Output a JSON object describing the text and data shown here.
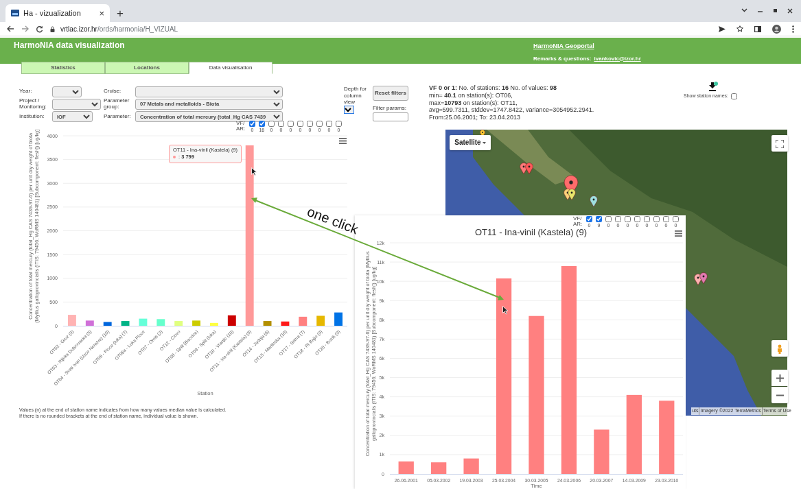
{
  "browser": {
    "tab_title": "Ha - vizualization",
    "tab_close": "×",
    "new_tab": "+",
    "url_host": "vrtlac.izor.hr",
    "url_path": "/ords/harmonia/H_VIZUAL"
  },
  "header": {
    "title": "HarmoNIA data visualization",
    "geoportal_link": "HarmoNIA Geoportal",
    "remarks_label": "Remarks & questions:",
    "remarks_email": "ivankovic@izor.hr"
  },
  "tabs": [
    {
      "label": "Statistics",
      "selected": false
    },
    {
      "label": "Locations",
      "selected": false
    },
    {
      "label": "Data visualisation",
      "selected": true
    }
  ],
  "filters": [
    {
      "label": "Year:"
    },
    {
      "label": "Cruise:"
    },
    {
      "label": "Project / Monitoring:"
    },
    {
      "label": "Parameter group:",
      "value": "07 Metals and metalloids - Biota"
    },
    {
      "label": "Institution:",
      "value": "IOF"
    },
    {
      "label": "Parameter:",
      "value": "Concentration of total mercury (total_Hg CAS 7439"
    }
  ],
  "depth": {
    "label": "Depth for column view"
  },
  "reset_button": "Reset filters",
  "filter_params": {
    "label": "Filter params:"
  },
  "station_chart": {
    "vf_ar": {
      "label_top": "VF/",
      "label_bottom": "AR:",
      "items": [
        {
          "checked": true,
          "count": "0"
        },
        {
          "checked": true,
          "count": "16"
        },
        {
          "checked": false,
          "count": "0"
        },
        {
          "checked": false,
          "count": "0"
        },
        {
          "checked": false,
          "count": "0"
        },
        {
          "checked": false,
          "count": "0"
        },
        {
          "checked": false,
          "count": "0"
        },
        {
          "checked": false,
          "count": "0"
        },
        {
          "checked": false,
          "count": "0"
        },
        {
          "checked": false,
          "count": "0"
        }
      ]
    },
    "tooltip": {
      "title": "OT11 - Ina-vinil (Kastela) (9)",
      "value": ": **3 799**",
      "color": "#ff9999"
    },
    "chart_data": {
      "type": "bar",
      "xlabel": "Station",
      "ylabel": "Concentration of total mercury (total_Hg CAS 7439-97-6) per unit dry weight of biota (Mytilus galloprovincialis (ITIS: 79456; WoRMS 140481) [Subcomponent: flesh]) [ug/kg]",
      "categories": [
        "OT02 - Gruz (9)",
        "OT03 - Rijeka Dubrovacka (5)",
        "OT04 - Sveti Ivan (Usce Neretve) (10)",
        "OT06 - Ploce (luka) (7)",
        "OT06a - Luka Ploce",
        "OT07 - Omis (3)",
        "OT12 - Ciovo",
        "OT08 - Split (Bacvice)",
        "OT09 - Split (luka)",
        "OT10 - Vranjic (10)",
        "OT11 - Ina-vinil (Kastela) (9)",
        "OT14 - Jadrija (6)",
        "OT15 - Martinska (10)",
        "OT17 - Srima (7)",
        "OT18 - Rt Bajlo (9)",
        "OT20 - Bozik (9)"
      ],
      "grid": true,
      "series": [
        {
          "colors": [
            "#ffb3b3",
            "#d070d8",
            "#0066dd",
            "#00b386",
            "#66ffd9",
            "#66ffcc",
            "#e0ff80",
            "#cccc00",
            "#ffff40",
            "#cc0000",
            "#ff9999",
            "#b38f00",
            "#ff1a1a",
            "#ff8080",
            "#e6b800",
            "#0073e6"
          ],
          "values": [
            230,
            110,
            80,
            100,
            150,
            140,
            100,
            110,
            60,
            220,
            3799,
            100,
            90,
            190,
            210,
            280
          ]
        }
      ],
      "ylim": [
        0,
        4000
      ],
      "yticks": [
        0,
        500,
        1000,
        1500,
        2000,
        2500,
        3000,
        3500,
        4000
      ]
    }
  },
  "notes": [
    "Values (n) at the end of station name indicates from how many values median value is calculated.",
    "If there is no rounded brackets at the end of station name, individual value is shown."
  ],
  "summary": [
    "**VF 0 or 1:** No. of stations: **16** No. of values: **98**",
    "min= **40.1** on station(s): OT06,",
    "max=**10793** on station(s): OT11,",
    "avg=599.7311, stddev=1747.8422, variance=3054952.2941.",
    "From:25.06.2001; To: 23.04.2013"
  ],
  "show_station_names": {
    "label": "Show station names:",
    "checked": false
  },
  "map": {
    "type_button": "Satellite",
    "attribution": [
      "uts",
      "Imagery ©2022 TerraMetrics",
      "Terms of Use"
    ]
  },
  "popup_chart": {
    "vf_ar": {
      "label_top": "VF/",
      "label_bottom": "AR:",
      "items": [
        {
          "checked": true,
          "count": "0"
        },
        {
          "checked": true,
          "count": "9"
        },
        {
          "checked": false,
          "count": "0"
        },
        {
          "checked": false,
          "count": "0"
        },
        {
          "checked": false,
          "count": "0"
        },
        {
          "checked": false,
          "count": "0"
        },
        {
          "checked": false,
          "count": "0"
        },
        {
          "checked": false,
          "count": "0"
        },
        {
          "checked": false,
          "count": "0"
        },
        {
          "checked": false,
          "count": "0"
        }
      ]
    },
    "chart_data": {
      "type": "bar",
      "title": "OT11 - Ina-vinil (Kastela) (9)",
      "xlabel": "Time",
      "ylabel": "Concentration of total mercury (total_Hg CAS 7439-97-6) per unit dry weight of biota (Mytilus galloprovincialis (ITIS: 79456; WoRMS 140481) [Subcomponent: flesh]) [ug/kg]",
      "categories": [
        "26.06.2001",
        "05.03.2002",
        "19.03.2003",
        "25.03.2004",
        "30.03.2005",
        "24.03.2006",
        "20.03.2007",
        "14.03.2009",
        "23.03.2010"
      ],
      "grid": true,
      "series": [
        {
          "color": "#ff8080",
          "values": [
            650,
            600,
            800,
            10150,
            8200,
            10793,
            2300,
            4100,
            3800
          ]
        }
      ],
      "ylim": [
        0,
        12000
      ],
      "yticks": [
        {
          "value": 0,
          "label": "0"
        },
        {
          "value": 1000,
          "label": "1k"
        },
        {
          "value": 2000,
          "label": "2k"
        },
        {
          "value": 3000,
          "label": "3k"
        },
        {
          "value": 4000,
          "label": "4k"
        },
        {
          "value": 5000,
          "label": "5k"
        },
        {
          "value": 6000,
          "label": "6k"
        },
        {
          "value": 7000,
          "label": "7k"
        },
        {
          "value": 8000,
          "label": "8k"
        },
        {
          "value": 9000,
          "label": "9k"
        },
        {
          "value": 10000,
          "label": "10k"
        },
        {
          "value": 11000,
          "label": "11k"
        },
        {
          "value": 12000,
          "label": "12k"
        }
      ]
    }
  },
  "annotation": {
    "text": "one click"
  }
}
